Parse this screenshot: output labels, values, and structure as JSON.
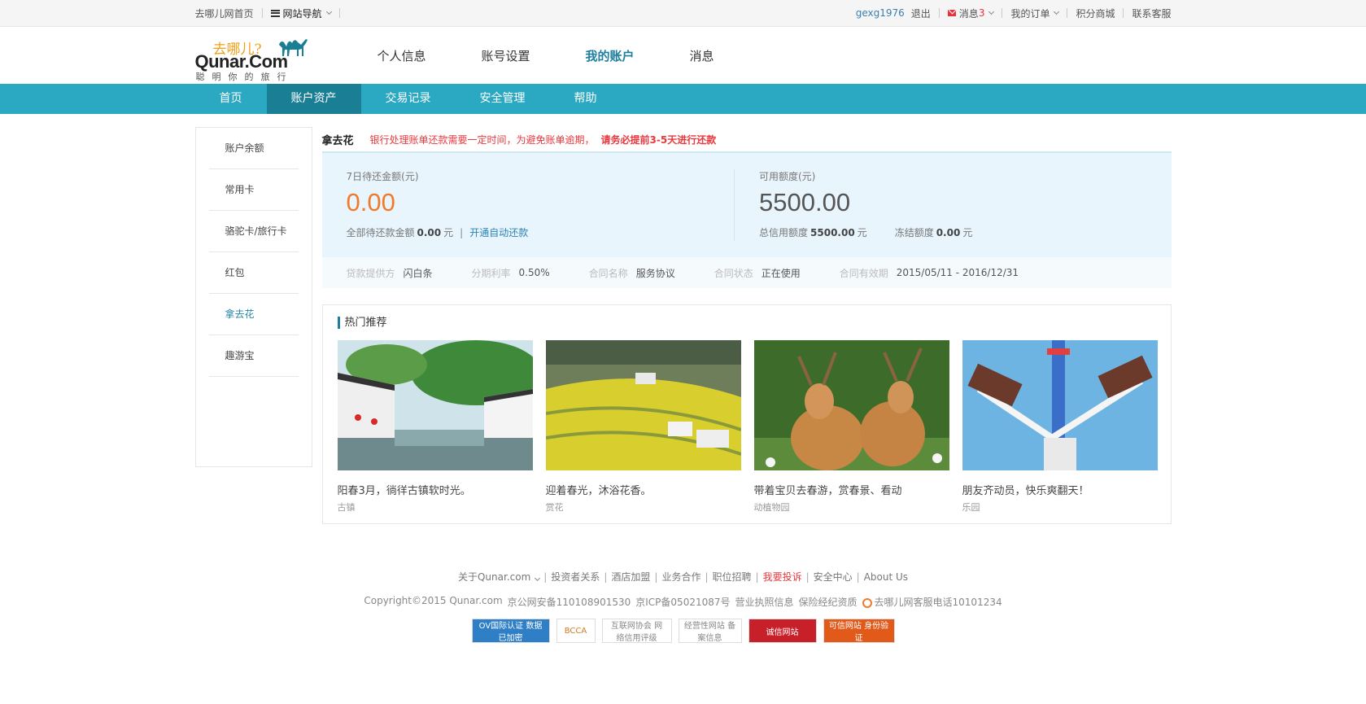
{
  "topbar": {
    "home_label": "去哪儿网首页",
    "site_nav_label": "网站导航",
    "username": "gexg1976",
    "logout_label": "退出",
    "message_label": "消息",
    "message_count": "3",
    "orders_label": "我的订单",
    "points_mall_label": "积分商城",
    "support_label": "联系客服"
  },
  "logo": {
    "cn": "去哪儿?",
    "en": "Qunar.Com",
    "slogan": "聪明你的旅行"
  },
  "main_nav": [
    {
      "label": "个人信息"
    },
    {
      "label": "账号设置"
    },
    {
      "label": "我的账户"
    },
    {
      "label": "消息"
    }
  ],
  "sub_nav": [
    {
      "label": "首页"
    },
    {
      "label": "账户资产"
    },
    {
      "label": "交易记录"
    },
    {
      "label": "安全管理"
    },
    {
      "label": "帮助"
    }
  ],
  "sidebar": [
    {
      "label": "账户余额"
    },
    {
      "label": "常用卡"
    },
    {
      "label": "骆驼卡/旅行卡"
    },
    {
      "label": "红包"
    },
    {
      "label": "拿去花"
    },
    {
      "label": "趣游宝"
    }
  ],
  "notice": {
    "title": "拿去花",
    "text": "银行处理账单还款需要一定时间，为避免账单逾期，",
    "strong": "请务必提前3-5天进行还款"
  },
  "summary": {
    "left": {
      "label": "7日待还金额(元)",
      "value": "0.00",
      "total_label": "全部待还款金额",
      "total_value": "0.00",
      "unit": "元",
      "auto_repay_link": "开通自动还款"
    },
    "right": {
      "label": "可用额度(元)",
      "value": "5500.00",
      "credit_label": "总信用额度",
      "credit_value": "5500.00",
      "frozen_label": "冻结额度",
      "frozen_value": "0.00",
      "unit": "元"
    }
  },
  "contract": {
    "provider_label": "贷款提供方",
    "provider_value": "闪白条",
    "rate_label": "分期利率",
    "rate_value": "0.50%",
    "name_label": "合同名称",
    "name_value": "服务协议",
    "status_label": "合同状态",
    "status_value": "正在使用",
    "period_label": "合同有效期",
    "period_value": "2015/05/11 - 2016/12/31"
  },
  "recommend": {
    "title": "热门推荐",
    "cards": [
      {
        "title": "阳春3月，徜徉古镇软时光。",
        "tag": "古镇"
      },
      {
        "title": "迎着春光，沐浴花香。",
        "tag": "赏花"
      },
      {
        "title": "带着宝贝去春游，赏春景、看动",
        "tag": "动植物园"
      },
      {
        "title": "朋友齐动员，快乐爽翻天！",
        "tag": "乐园"
      }
    ]
  },
  "footer": {
    "links": [
      "关于Qunar.com",
      "投资者关系",
      "酒店加盟",
      "业务合作",
      "职位招聘",
      "我要投诉",
      "安全中心",
      "About Us"
    ],
    "copyright": "Copyright©2015 Qunar.com",
    "icp1": "京公网安备110108901530",
    "icp2": "京ICP备05021087号",
    "license": "营业执照信息",
    "insurance": "保险经纪资质",
    "hotline": "去哪儿网客服电话10101234",
    "badges": [
      "OV国际认证 数据已加密",
      "BCCA",
      "互联网协会 网络信用评级",
      "经营性网站 备案信息",
      "诚信网站",
      "可信网站 身份验证"
    ]
  },
  "colors": {
    "accent": "#2ba9c2",
    "accent_dark": "#1a7f95",
    "alert": "#e8383d",
    "orange": "#f07a2a"
  }
}
